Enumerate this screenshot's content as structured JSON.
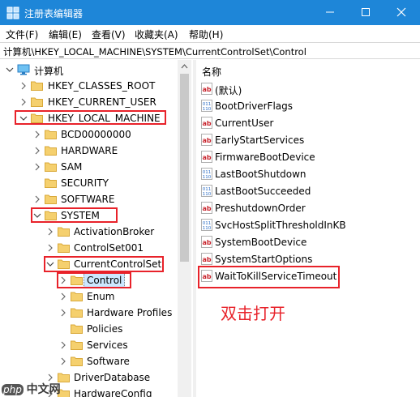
{
  "window": {
    "title": "注册表编辑器",
    "title_bg": "#1e86d8"
  },
  "menu": [
    "文件(F)",
    "编辑(E)",
    "查看(V)",
    "收藏夹(A)",
    "帮助(H)"
  ],
  "address": "计算机\\HKEY_LOCAL_MACHINE\\SYSTEM\\CurrentControlSet\\Control",
  "tree": {
    "root": "计算机",
    "hkcr": "HKEY_CLASSES_ROOT",
    "hkcu": "HKEY_CURRENT_USER",
    "hklm": "HKEY_LOCAL_MACHINE",
    "bcd": "BCD00000000",
    "hardware": "HARDWARE",
    "sam": "SAM",
    "security": "SECURITY",
    "software": "SOFTWARE",
    "system": "SYSTEM",
    "activation": "ActivationBroker",
    "ccs001": "ControlSet001",
    "ccs": "CurrentControlSet",
    "control": "Control",
    "enum": "Enum",
    "hwprofiles": "Hardware Profiles",
    "policies": "Policies",
    "services": "Services",
    "softwaresub": "Software",
    "driverdb": "DriverDatabase",
    "hwconfig": "HardwareConfig"
  },
  "values_header": "名称",
  "values": [
    "(默认)",
    "BootDriverFlags",
    "CurrentUser",
    "EarlyStartServices",
    "FirmwareBootDevice",
    "LastBootShutdown",
    "LastBootSucceeded",
    "PreshutdownOrder",
    "SvcHostSplitThresholdInKB",
    "SystemBootDevice",
    "SystemStartOptions",
    "WaitToKillServiceTimeout"
  ],
  "value_icons": [
    "ab-icon",
    "binary-icon",
    "ab-icon",
    "ab-icon",
    "ab-icon",
    "binary-icon",
    "binary-icon",
    "ab-icon",
    "binary-icon",
    "ab-icon",
    "ab-icon",
    "ab-icon"
  ],
  "annotation": "双击打开",
  "watermark": {
    "php": "php",
    "cn": "中文网"
  },
  "colors": {
    "highlight_box": "#e8222a",
    "selection": "#cce8ff",
    "folder": "#f2c94c"
  }
}
